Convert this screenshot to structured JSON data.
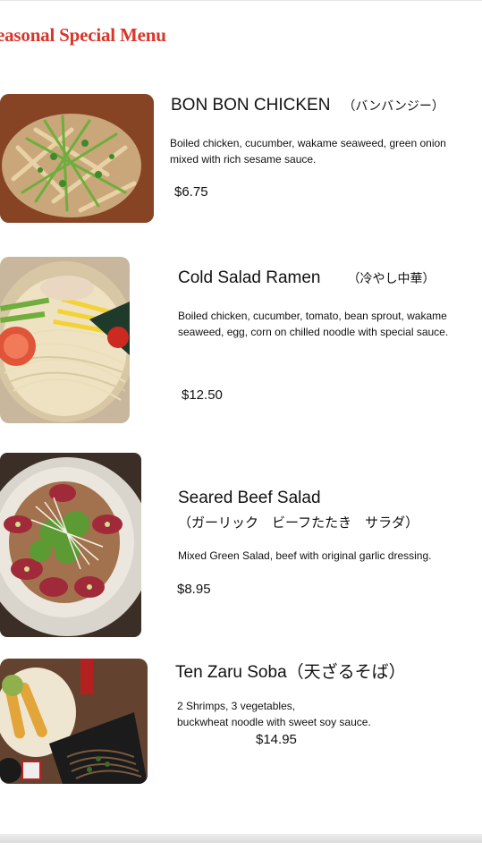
{
  "menu": {
    "title": "easonal Special Menu"
  },
  "items": [
    {
      "name": "BON BON CHICKEN",
      "name_jp": "（バンバンジー）",
      "description": "Boiled chicken, cucumber, wakame seaweed, green onion mixed with rich sesame sauce.",
      "price": "$6.75",
      "photo_icon": "bonbon-chicken-photo"
    },
    {
      "name": "Cold Salad Ramen",
      "name_jp": "（冷やし中華）",
      "description": "Boiled chicken, cucumber, tomato, bean sprout, wakame seaweed, egg, corn on chilled noodle with special sauce.",
      "price": "$12.50",
      "photo_icon": "cold-salad-ramen-photo"
    },
    {
      "name": "Seared Beef Salad",
      "name_jp": "（ガーリック　ビーフたたき　サラダ）",
      "description": "Mixed Green Salad, beef with original garlic dressing.",
      "price": "$8.95",
      "photo_icon": "seared-beef-salad-photo"
    },
    {
      "name": "Ten Zaru Soba（天ざるそば）",
      "description_line1": "2 Shrimps, 3 vegetables,",
      "description_line2": "buckwheat noodle with sweet soy sauce.",
      "price": "$14.95",
      "photo_icon": "ten-zaru-soba-photo"
    }
  ],
  "colors": {
    "title": "#d9352a",
    "text": "#111111",
    "background": "#ffffff"
  }
}
